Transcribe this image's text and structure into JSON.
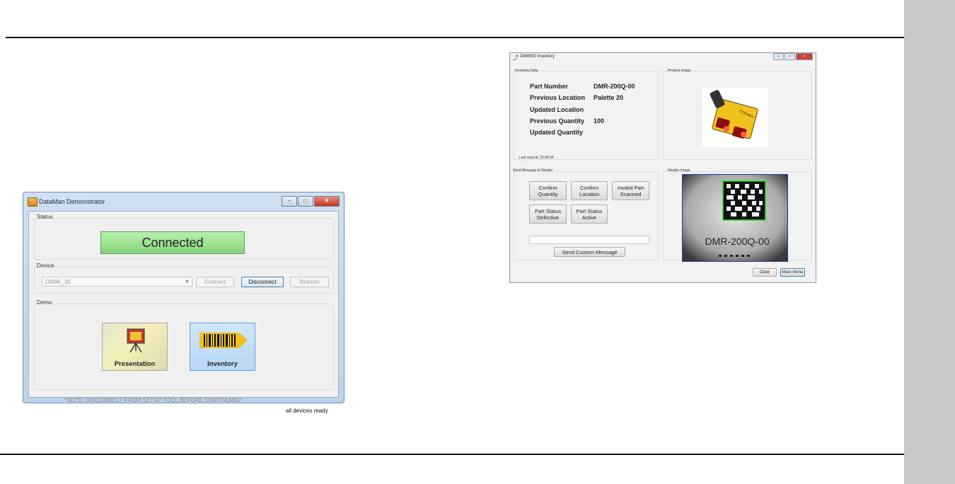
{
  "dataman": {
    "title": "DataMan Demonstrator",
    "status_group": "Status",
    "status_text": "Connected",
    "device_group": "Device",
    "device_value": "DM9K_30",
    "connect": "Connect",
    "disconnect": "Disconnect",
    "refresh": "Refresh",
    "demo_group": "Demo",
    "presentation": "Presentation",
    "inventory": "Inventory",
    "note": "*NOTE: DISCONNECT FROM SETUP TOOL BEFORE CONTINUING*",
    "footer_status": "all devices ready"
  },
  "inventory_window": {
    "title": "DM8500 Inventory",
    "inventory_data": "Inventory Data",
    "rows": [
      {
        "label": "Part Number",
        "value": "DMR-200Q-00"
      },
      {
        "label": "Previous Location",
        "value": "Palette 20"
      },
      {
        "label": "Updated Location",
        "value": ""
      },
      {
        "label": "Previous Quantity",
        "value": "100"
      },
      {
        "label": "Updated Quantity",
        "value": ""
      }
    ],
    "last_read": "Last read at: 15:48:34",
    "product_image": "Product Image",
    "product_brand": "COGNEX",
    "send_message": "Send Message to Reader",
    "buttons": [
      "Confirm\nQuantity",
      "Confirm\nLocation",
      "Invalid Part\nScanned",
      "Part Status\nDefective",
      "Part Status\nActive"
    ],
    "send_custom": "Send Custom Message",
    "reader_image": "Reader Image",
    "reader_code_text": "DMR-200Q-00",
    "clear": "Clear",
    "main_menu": "Main Menu"
  }
}
